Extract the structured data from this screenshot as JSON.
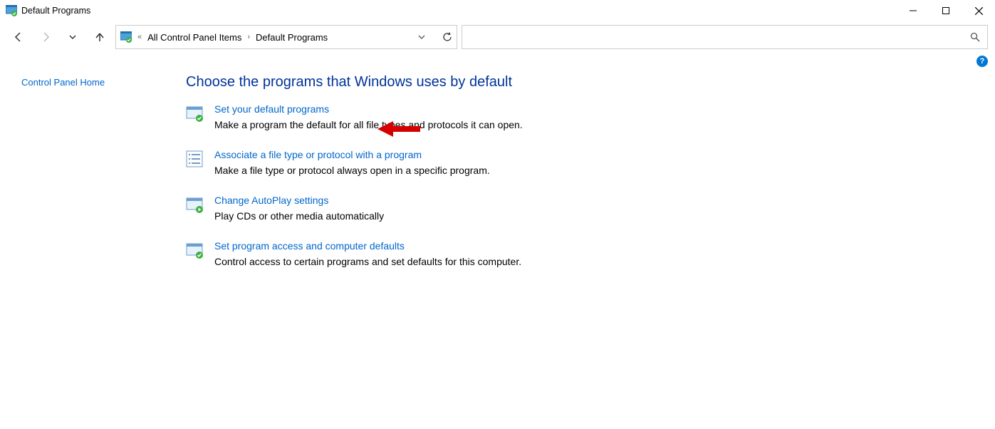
{
  "window": {
    "title": "Default Programs"
  },
  "breadcrumb": {
    "item1": "All Control Panel Items",
    "item2": "Default Programs"
  },
  "sidebar": {
    "home": "Control Panel Home"
  },
  "main": {
    "heading": "Choose the programs that Windows uses by default",
    "options": [
      {
        "title": "Set your default programs",
        "desc": "Make a program the default for all file types and protocols it can open."
      },
      {
        "title": "Associate a file type or protocol with a program",
        "desc": "Make a file type or protocol always open in a specific program."
      },
      {
        "title": "Change AutoPlay settings",
        "desc": "Play CDs or other media automatically"
      },
      {
        "title": "Set program access and computer defaults",
        "desc": "Control access to certain programs and set defaults for this computer."
      }
    ]
  },
  "help": {
    "label": "?"
  }
}
